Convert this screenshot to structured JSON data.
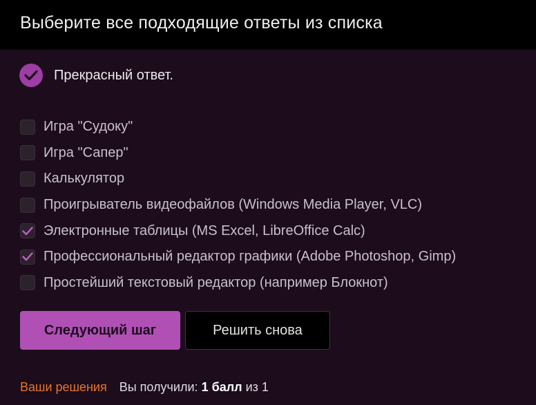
{
  "header": {
    "title": "Выберите все подходящие ответы из списка"
  },
  "feedback": {
    "icon": "check-circle-icon",
    "text": "Прекрасный ответ."
  },
  "options": [
    {
      "label": "Игра \"Судоку\"",
      "checked": false
    },
    {
      "label": "Игра \"Сапер\"",
      "checked": false
    },
    {
      "label": "Калькулятор",
      "checked": false
    },
    {
      "label": "Проигрыватель видеофайлов (Windows Media Player, VLC)",
      "checked": false
    },
    {
      "label": "Электронные таблицы (MS Excel, LibreOffice Calc)",
      "checked": true
    },
    {
      "label": "Профессиональный редактор графики (Adobe Photoshop, Gimp)",
      "checked": true
    },
    {
      "label": "Простейший текстовый редактор (например Блокнот)",
      "checked": false
    }
  ],
  "buttons": {
    "next_label": "Следующий шаг",
    "retry_label": "Решить снова"
  },
  "footer": {
    "solutions_link": "Ваши решения",
    "score_prefix": "Вы получили:",
    "score_value": "1 балл",
    "score_suffix": "из 1"
  },
  "colors": {
    "background": "#1c0c1c",
    "header": "#000000",
    "accent": "#b050b5",
    "link": "#e8742a"
  }
}
